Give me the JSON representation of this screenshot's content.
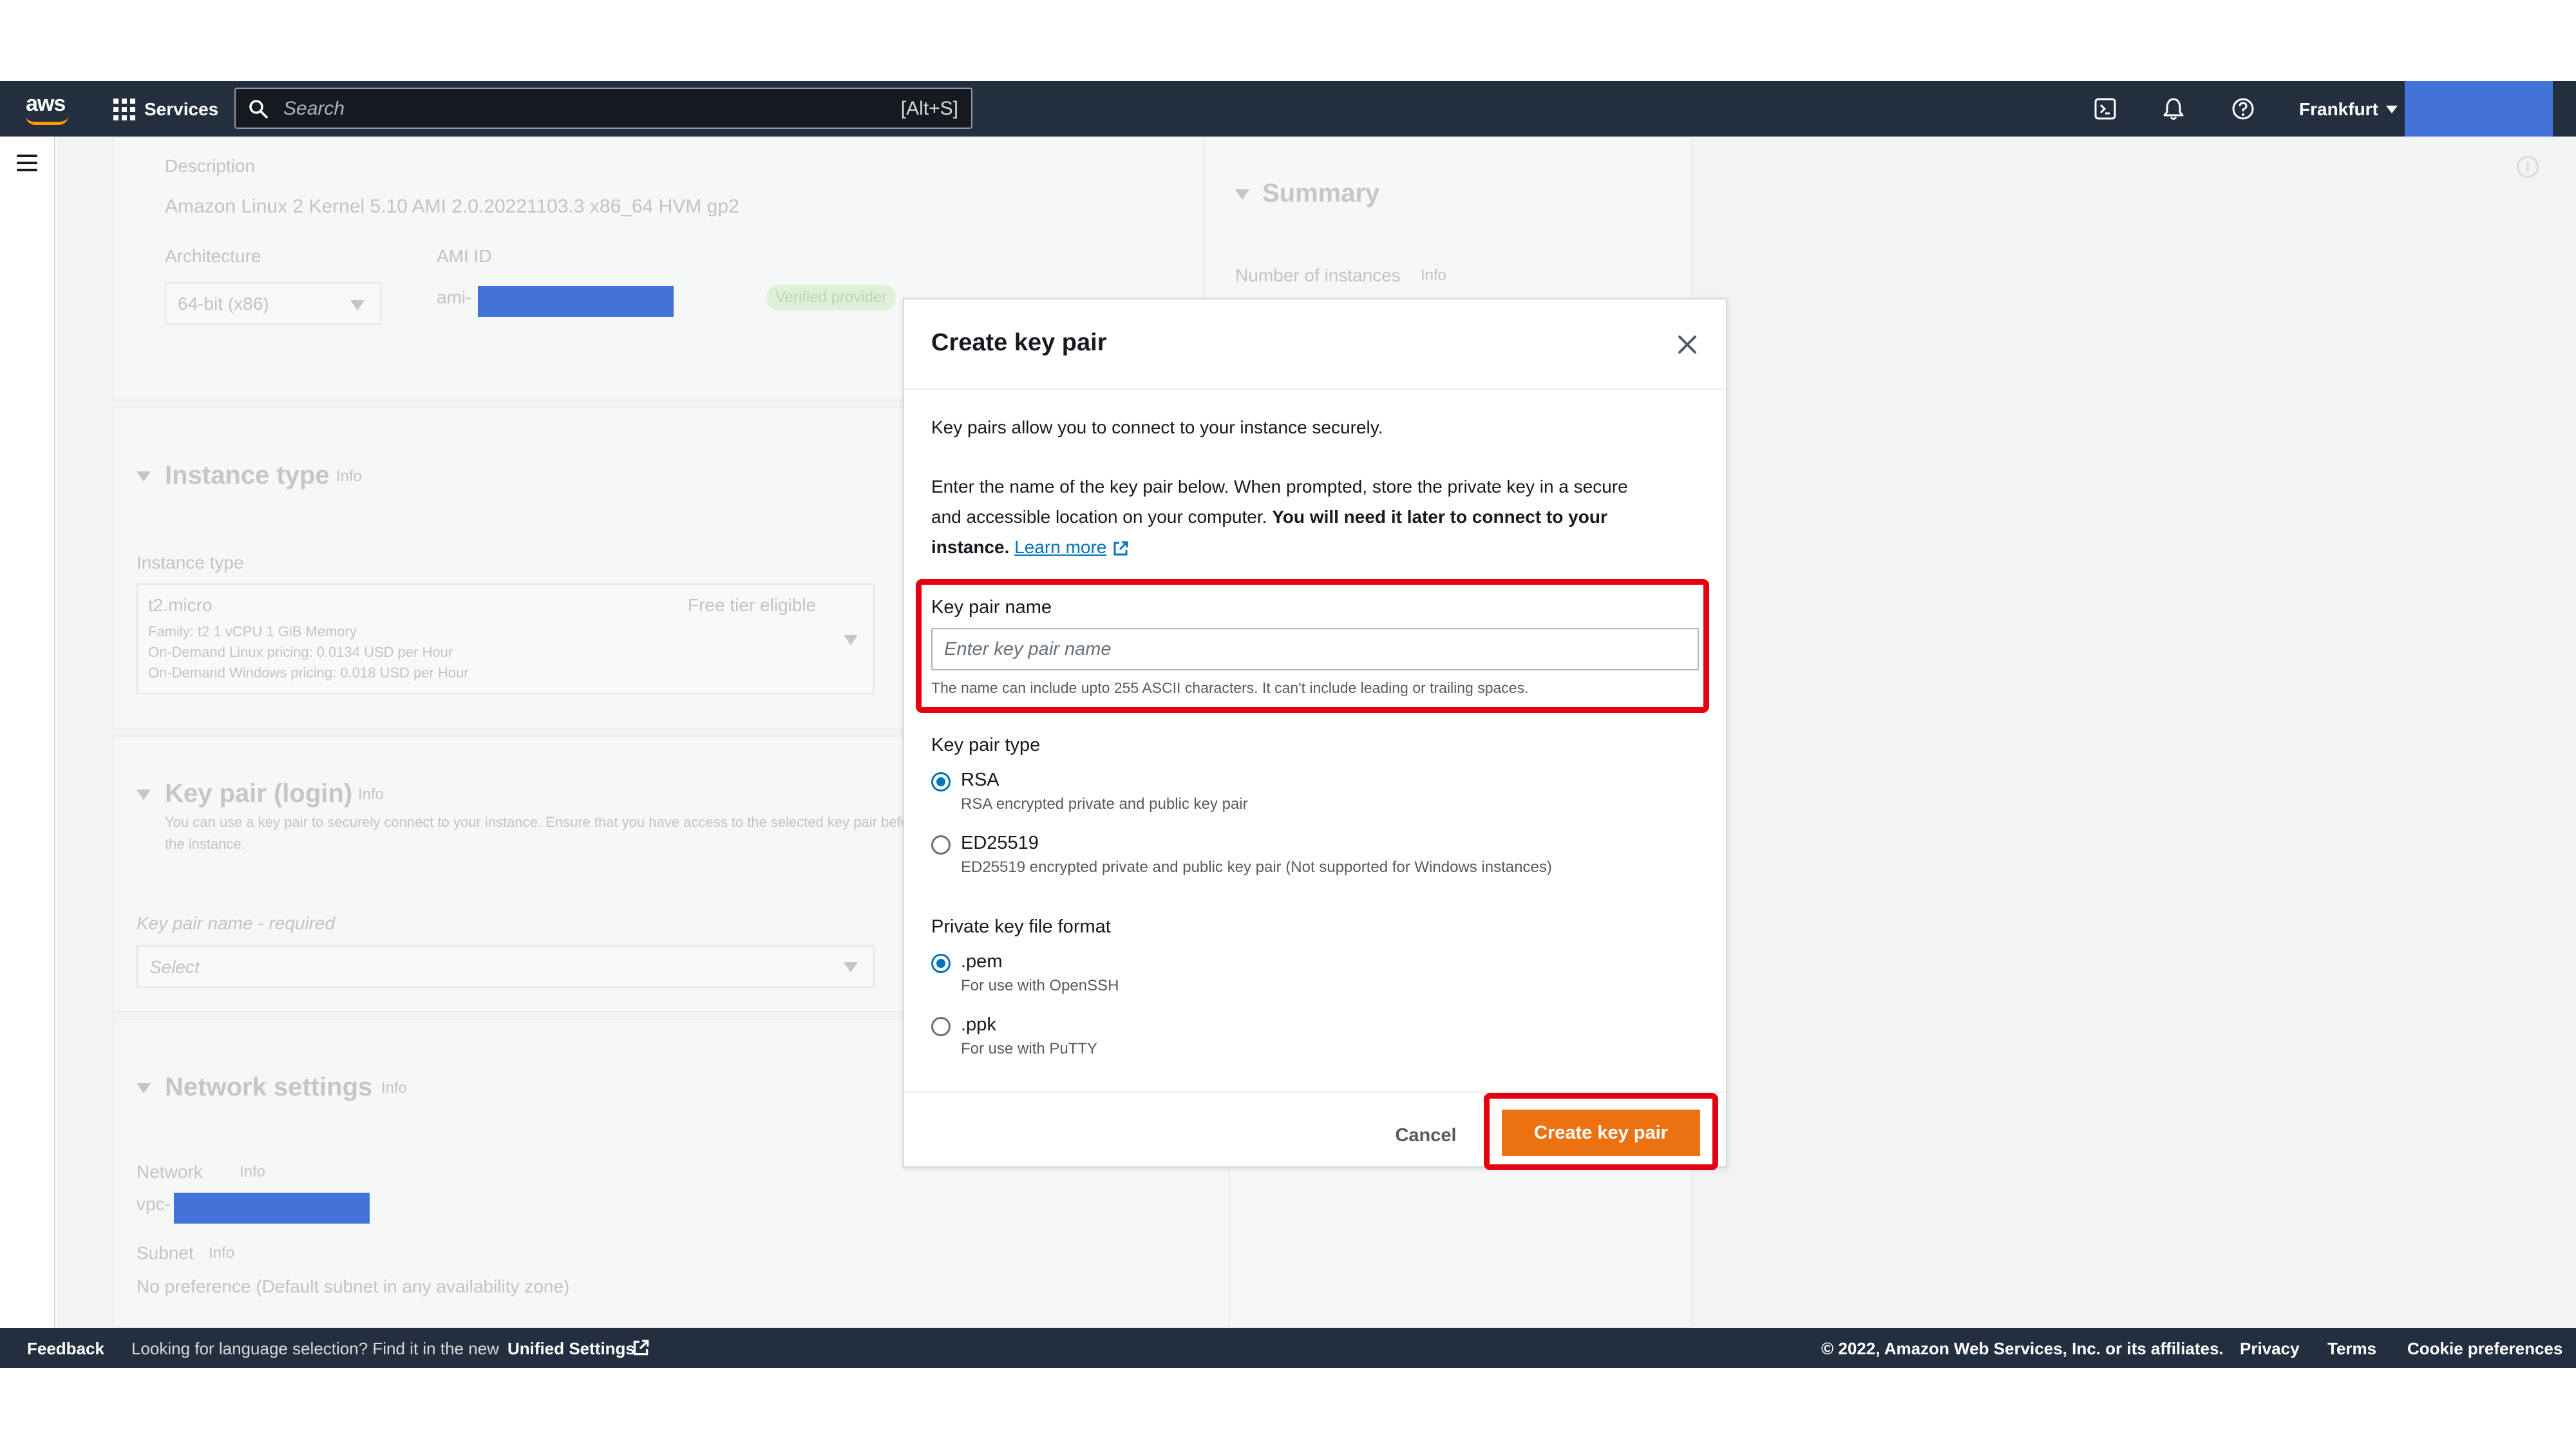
{
  "topnav": {
    "logo_text": "aws",
    "services_label": "Services",
    "search_placeholder": "Search",
    "search_shortcut": "[Alt+S]",
    "region": "Frankfurt"
  },
  "background": {
    "description_label": "Description",
    "description_value": "Amazon Linux 2 Kernel 5.10 AMI 2.0.20221103.3 x86_64 HVM gp2",
    "architecture_label": "Architecture",
    "architecture_value": "64-bit (x86)",
    "ami_id_label": "AMI ID",
    "ami_prefix": "ami-",
    "verified_badge": "Verified provider",
    "summary_title": "Summary",
    "number_of_instances": "Number of instances",
    "info": "Info",
    "instance_type_title": "Instance type",
    "instance_type_label": "Instance type",
    "instance_type_value": "t2.micro",
    "free_tier": "Free tier eligible",
    "instance_spec": "Family: t2    1 vCPU    1 GiB Memory",
    "linux_pricing": "On-Demand Linux pricing: 0.0134 USD per Hour",
    "windows_pricing": "On-Demand Windows pricing: 0.018 USD per Hour",
    "key_pair_title": "Key pair (login)",
    "key_pair_desc_1": "You can use a key pair to securely connect to your instance. Ensure that you have access to the selected key pair before you launch",
    "key_pair_desc_2": "the instance.",
    "key_pair_name_label": "Key pair name - required",
    "key_pair_select": "Select",
    "network_title": "Network settings",
    "network_label": "Network",
    "vpc_prefix": "vpc-",
    "subnet_label": "Subnet",
    "subnet_value": "No preference (Default subnet in any availability zone)"
  },
  "modal": {
    "title": "Create key pair",
    "intro": "Key pairs allow you to connect to your instance securely.",
    "para_1": "Enter the name of the key pair below. When prompted, store the private key in a secure",
    "para_2a": "and accessible location on your computer. ",
    "para_2b": "You will need it later to connect to your",
    "para_3a": "instance.",
    "learn_more": "Learn more",
    "key_pair_name_label": "Key pair name",
    "key_pair_name_placeholder": "Enter key pair name",
    "key_pair_name_value": "",
    "key_pair_name_help": "The name can include upto 255 ASCII characters. It can't include leading or trailing spaces.",
    "key_pair_type_label": "Key pair type",
    "type_options": [
      {
        "label": "RSA",
        "desc": "RSA encrypted private and public key pair",
        "selected": true
      },
      {
        "label": "ED25519",
        "desc": "ED25519 encrypted private and public key pair (Not supported for Windows instances)",
        "selected": false
      }
    ],
    "format_label": "Private key file format",
    "format_options": [
      {
        "label": ".pem",
        "desc": "For use with OpenSSH",
        "selected": true
      },
      {
        "label": ".ppk",
        "desc": "For use with PuTTY",
        "selected": false
      }
    ],
    "cancel_label": "Cancel",
    "create_label": "Create key pair"
  },
  "footer": {
    "feedback": "Feedback",
    "language_text": "Looking for language selection? Find it in the new",
    "unified_settings": "Unified Settings",
    "copyright": "© 2022, Amazon Web Services, Inc. or its affiliates.",
    "privacy": "Privacy",
    "terms": "Terms",
    "cookie": "Cookie preferences"
  },
  "colors": {
    "nav_bg": "#232f3e",
    "primary_button": "#ec7211",
    "highlight": "#e3000f",
    "link": "#0073bb",
    "redaction": "#4273d9"
  }
}
